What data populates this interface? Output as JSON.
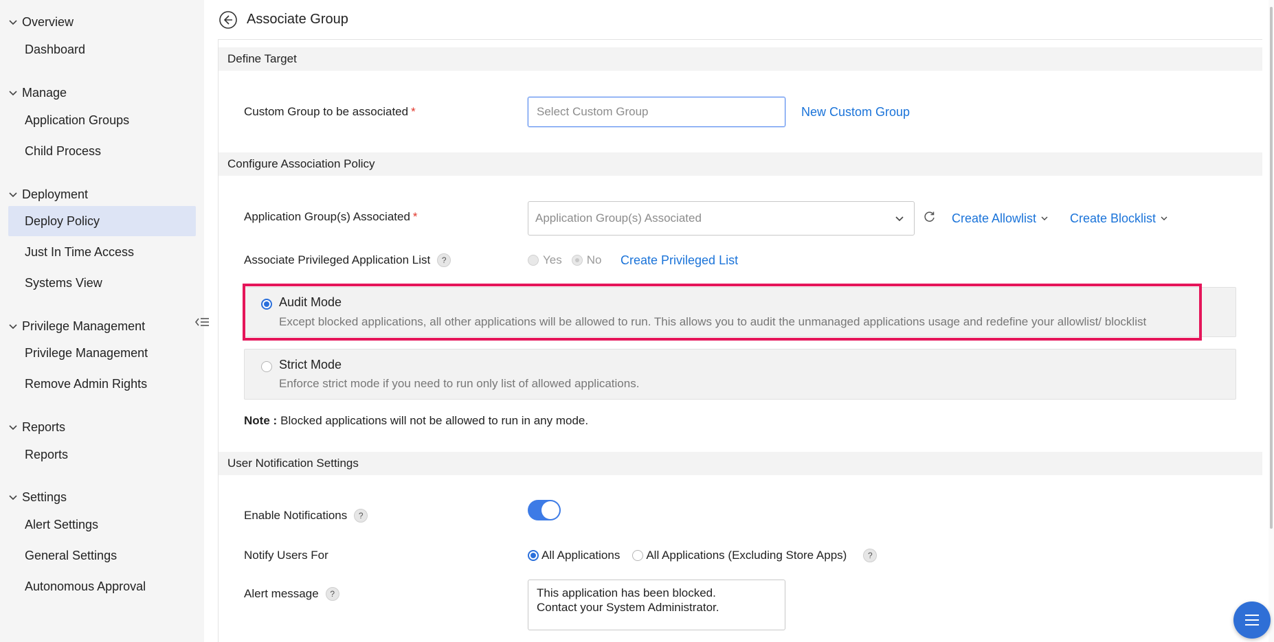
{
  "page": {
    "title": "Associate Group"
  },
  "sidebar": {
    "sections": [
      {
        "title": "Overview",
        "items": [
          "Dashboard"
        ]
      },
      {
        "title": "Manage",
        "items": [
          "Application Groups",
          "Child Process"
        ]
      },
      {
        "title": "Deployment",
        "items": [
          "Deploy Policy",
          "Just In Time Access",
          "Systems View"
        ]
      },
      {
        "title": "Privilege Management",
        "items": [
          "Privilege Management",
          "Remove Admin Rights"
        ]
      },
      {
        "title": "Reports",
        "items": [
          "Reports"
        ]
      },
      {
        "title": "Settings",
        "items": [
          "Alert Settings",
          "General Settings",
          "Autonomous Approval"
        ]
      }
    ],
    "active_item": "Deploy Policy"
  },
  "define_target": {
    "section_title": "Define Target",
    "custom_group_label": "Custom Group to be associated",
    "custom_group_placeholder": "Select Custom Group",
    "new_custom_group_link": "New Custom Group"
  },
  "association_policy": {
    "section_title": "Configure Association Policy",
    "app_groups_label": "Application Group(s) Associated",
    "app_groups_placeholder": "Application Group(s) Associated",
    "create_allowlist": "Create Allowlist",
    "create_blocklist": "Create Blocklist",
    "privileged_list_label": "Associate Privileged Application List",
    "yes_label": "Yes",
    "no_label": "No",
    "create_privileged_list": "Create Privileged List",
    "audit_mode": {
      "title": "Audit Mode",
      "description": "Except blocked applications, all other applications will be allowed to run. This allows you to audit the unmanaged applications usage and redefine your allowlist/ blocklist",
      "selected": true
    },
    "strict_mode": {
      "title": "Strict Mode",
      "description": "Enforce strict mode if you need to run only list of allowed applications.",
      "selected": false
    },
    "note_prefix": "Note :",
    "note_text": "Blocked applications will not be allowed to run in any mode."
  },
  "notifications": {
    "section_title": "User Notification Settings",
    "enable_label": "Enable Notifications",
    "enabled": true,
    "notify_for_label": "Notify Users For",
    "option_all": "All Applications",
    "option_excl": "All Applications (Excluding Store Apps)",
    "selected_option": "All Applications",
    "alert_message_label": "Alert message",
    "alert_message_value": "This application has been blocked.\nContact your System Administrator."
  },
  "colors": {
    "accent": "#2a6fdb",
    "link": "#1a73d9",
    "highlight": "#e5165a",
    "required": "#e0362b"
  }
}
